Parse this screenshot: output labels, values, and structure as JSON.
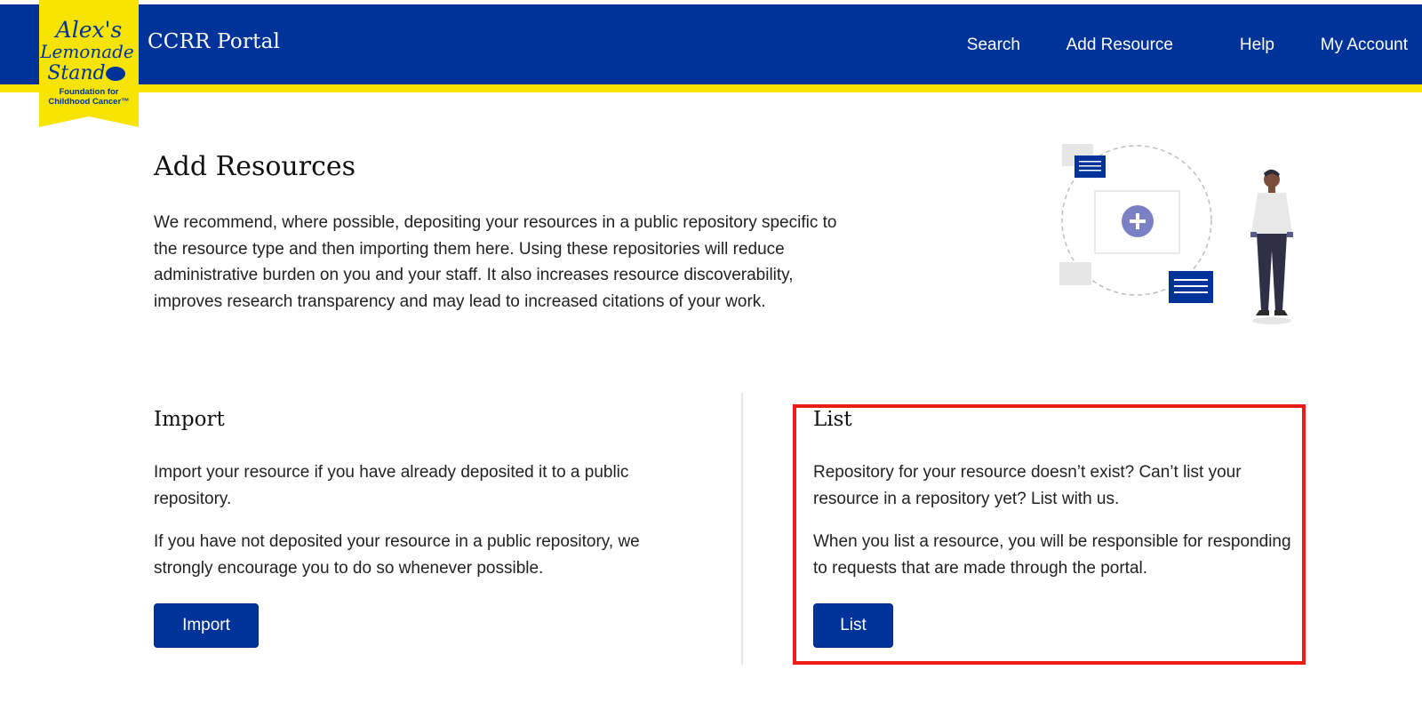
{
  "header": {
    "logo": {
      "line1": "Alex's",
      "line2": "Lemonade",
      "line3": "Stand",
      "tagline1": "Foundation for",
      "tagline2": "Childhood Cancer™"
    },
    "portal_title": "CCRR Portal",
    "nav": [
      {
        "label": "Search"
      },
      {
        "label": "Add Resource"
      },
      {
        "label": "Help"
      },
      {
        "label": "My Account"
      }
    ]
  },
  "main": {
    "title": "Add Resources",
    "intro": "We recommend, where possible, depositing your resources in a public repository specific to the resource type and then importing them here. Using these repositories will reduce administrative burden on you and your staff. It also increases resource discoverability, improves research transparency and may lead to increased citations of your work.",
    "import": {
      "title": "Import",
      "para1": "Import your resource if you have already deposited it to a public repository.",
      "para2": "If you have not deposited your resource in a public repository, we strongly encourage you to do so whenever possible.",
      "button_label": "Import"
    },
    "list": {
      "title": "List",
      "para1": "Repository for your resource doesn’t exist? Can’t list your resource in a repository yet? List with us.",
      "para2": "When you list a resource, you will be responsible for responding to requests that are made through the portal.",
      "button_label": "List"
    }
  },
  "colors": {
    "brand_blue": "#003399",
    "brand_yellow": "#f7e400",
    "highlight_red": "#ee1c14",
    "illustration_purple": "#7b7fc4"
  },
  "icons": {
    "add_icon": "plus-circle-icon",
    "document_icon": "document-lines-icon"
  }
}
